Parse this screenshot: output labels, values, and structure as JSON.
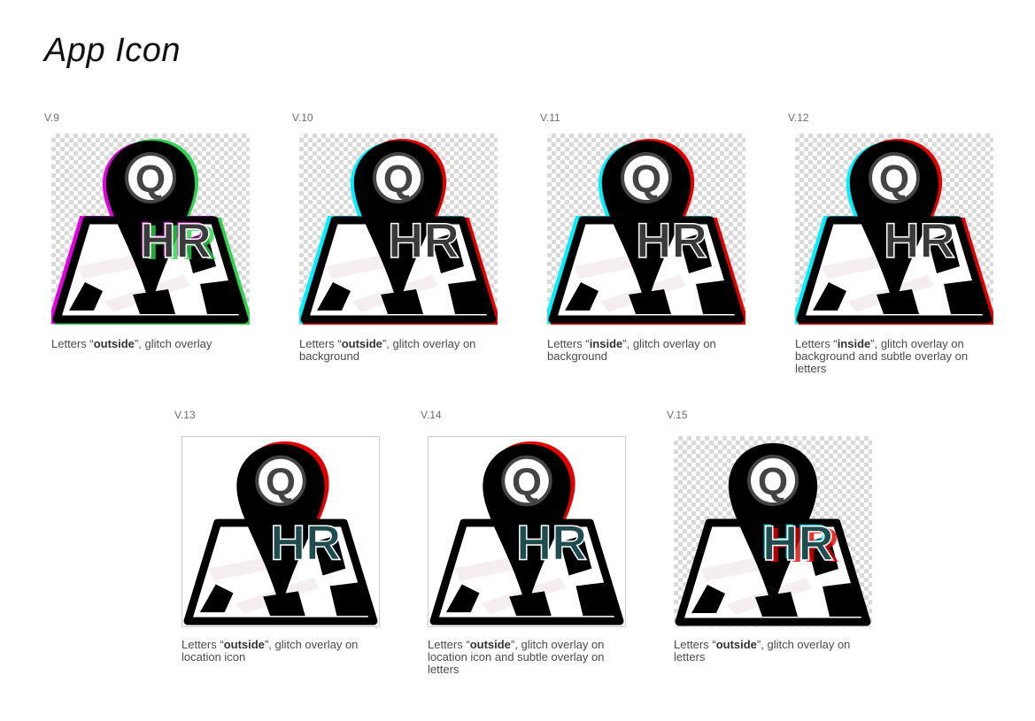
{
  "page": {
    "title": "App Icon"
  },
  "variants": [
    {
      "label": "V.9",
      "caption_pre": "Letters “",
      "caption_bold": "outside",
      "caption_post": "”, glitch overlay",
      "background": "checker",
      "glitch": "magenta-green",
      "icon": "location-pin-map-icon"
    },
    {
      "label": "V.10",
      "caption_pre": "Letters “",
      "caption_bold": "outside",
      "caption_post": "”, glitch overlay on background",
      "background": "checker",
      "glitch": "cyan-red",
      "icon": "location-pin-map-icon"
    },
    {
      "label": "V.11",
      "caption_pre": "Letters “",
      "caption_bold": "inside",
      "caption_post": "”, glitch overlay on background",
      "background": "checker",
      "glitch": "cyan-red",
      "icon": "location-pin-map-icon"
    },
    {
      "label": "V.12",
      "caption_pre": "Letters “",
      "caption_bold": "inside",
      "caption_post": "”, glitch overlay on background and subtle overlay on  letters",
      "background": "checker",
      "glitch": "cyan-red",
      "icon": "location-pin-map-icon"
    },
    {
      "label": "V.13",
      "caption_pre": "Letters “",
      "caption_bold": "outside",
      "caption_post": "”, glitch overlay on location icon",
      "background": "plain",
      "glitch": "red-pin",
      "icon": "location-pin-map-icon"
    },
    {
      "label": "V.14",
      "caption_pre": "Letters “",
      "caption_bold": "outside",
      "caption_post": "”, glitch overlay on location icon and subtle overlay on letters",
      "background": "plain",
      "glitch": "red-pin",
      "icon": "location-pin-map-icon"
    },
    {
      "label": "V.15",
      "caption_pre": "Letters “",
      "caption_bold": "outside",
      "caption_post": "”, glitch overlay on letters",
      "background": "checker",
      "glitch": "letters",
      "icon": "location-pin-map-icon"
    }
  ],
  "letters": {
    "top": "Q",
    "left": "H",
    "right": "R"
  },
  "colors": {
    "black": "#000000",
    "letters_teal": "#1f4d4f",
    "letters_grey": "#3a3a3a",
    "map_light": "#f4eef0",
    "glitch_cyan": "#00f0ff",
    "glitch_red": "#e00000",
    "glitch_magenta": "#e000e0",
    "glitch_green": "#30d050"
  }
}
